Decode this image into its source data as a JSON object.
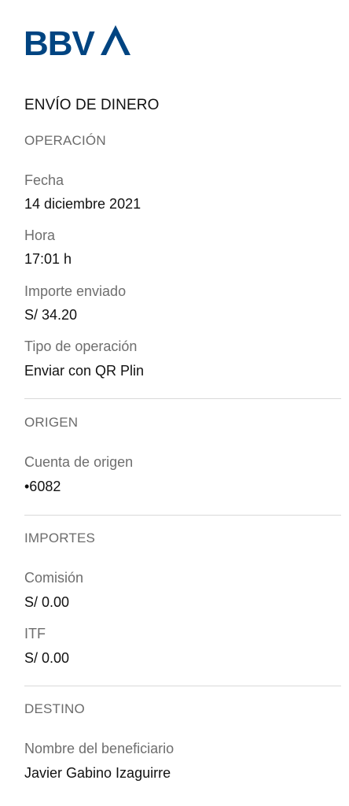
{
  "brand": {
    "logo_text": "BBVA",
    "color": "#004481"
  },
  "receipt": {
    "title": "ENVÍO DE DINERO",
    "operation": {
      "heading": "OPERACIÓN",
      "fecha_label": "Fecha",
      "fecha_value": "14 diciembre 2021",
      "hora_label": "Hora",
      "hora_value": "17:01 h",
      "importe_label": "Importe enviado",
      "importe_value": "S/ 34.20",
      "tipo_label": "Tipo de operación",
      "tipo_value": "Enviar con QR Plin"
    },
    "origin": {
      "heading": "ORIGEN",
      "cuenta_label": "Cuenta de origen",
      "cuenta_value": "•6082"
    },
    "amounts": {
      "heading": "IMPORTES",
      "comision_label": "Comisión",
      "comision_value": "S/ 0.00",
      "itf_label": "ITF",
      "itf_value": "S/ 0.00"
    },
    "destination": {
      "heading": "DESTINO",
      "beneficiario_label": "Nombre del beneficiario",
      "beneficiario_value": "Javier Gabino Izaguirre"
    }
  }
}
